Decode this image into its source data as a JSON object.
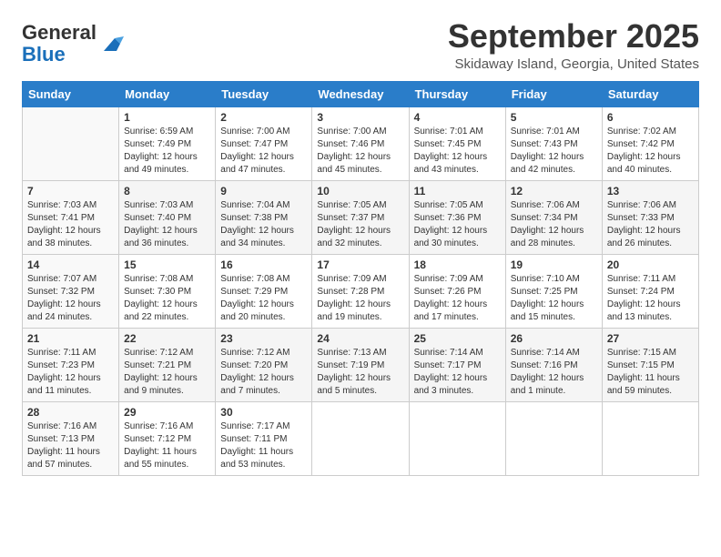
{
  "header": {
    "logo_line1": "General",
    "logo_line2": "Blue",
    "month": "September 2025",
    "location": "Skidaway Island, Georgia, United States"
  },
  "weekdays": [
    "Sunday",
    "Monday",
    "Tuesday",
    "Wednesday",
    "Thursday",
    "Friday",
    "Saturday"
  ],
  "weeks": [
    [
      {
        "day": "",
        "info": ""
      },
      {
        "day": "1",
        "info": "Sunrise: 6:59 AM\nSunset: 7:49 PM\nDaylight: 12 hours\nand 49 minutes."
      },
      {
        "day": "2",
        "info": "Sunrise: 7:00 AM\nSunset: 7:47 PM\nDaylight: 12 hours\nand 47 minutes."
      },
      {
        "day": "3",
        "info": "Sunrise: 7:00 AM\nSunset: 7:46 PM\nDaylight: 12 hours\nand 45 minutes."
      },
      {
        "day": "4",
        "info": "Sunrise: 7:01 AM\nSunset: 7:45 PM\nDaylight: 12 hours\nand 43 minutes."
      },
      {
        "day": "5",
        "info": "Sunrise: 7:01 AM\nSunset: 7:43 PM\nDaylight: 12 hours\nand 42 minutes."
      },
      {
        "day": "6",
        "info": "Sunrise: 7:02 AM\nSunset: 7:42 PM\nDaylight: 12 hours\nand 40 minutes."
      }
    ],
    [
      {
        "day": "7",
        "info": "Sunrise: 7:03 AM\nSunset: 7:41 PM\nDaylight: 12 hours\nand 38 minutes."
      },
      {
        "day": "8",
        "info": "Sunrise: 7:03 AM\nSunset: 7:40 PM\nDaylight: 12 hours\nand 36 minutes."
      },
      {
        "day": "9",
        "info": "Sunrise: 7:04 AM\nSunset: 7:38 PM\nDaylight: 12 hours\nand 34 minutes."
      },
      {
        "day": "10",
        "info": "Sunrise: 7:05 AM\nSunset: 7:37 PM\nDaylight: 12 hours\nand 32 minutes."
      },
      {
        "day": "11",
        "info": "Sunrise: 7:05 AM\nSunset: 7:36 PM\nDaylight: 12 hours\nand 30 minutes."
      },
      {
        "day": "12",
        "info": "Sunrise: 7:06 AM\nSunset: 7:34 PM\nDaylight: 12 hours\nand 28 minutes."
      },
      {
        "day": "13",
        "info": "Sunrise: 7:06 AM\nSunset: 7:33 PM\nDaylight: 12 hours\nand 26 minutes."
      }
    ],
    [
      {
        "day": "14",
        "info": "Sunrise: 7:07 AM\nSunset: 7:32 PM\nDaylight: 12 hours\nand 24 minutes."
      },
      {
        "day": "15",
        "info": "Sunrise: 7:08 AM\nSunset: 7:30 PM\nDaylight: 12 hours\nand 22 minutes."
      },
      {
        "day": "16",
        "info": "Sunrise: 7:08 AM\nSunset: 7:29 PM\nDaylight: 12 hours\nand 20 minutes."
      },
      {
        "day": "17",
        "info": "Sunrise: 7:09 AM\nSunset: 7:28 PM\nDaylight: 12 hours\nand 19 minutes."
      },
      {
        "day": "18",
        "info": "Sunrise: 7:09 AM\nSunset: 7:26 PM\nDaylight: 12 hours\nand 17 minutes."
      },
      {
        "day": "19",
        "info": "Sunrise: 7:10 AM\nSunset: 7:25 PM\nDaylight: 12 hours\nand 15 minutes."
      },
      {
        "day": "20",
        "info": "Sunrise: 7:11 AM\nSunset: 7:24 PM\nDaylight: 12 hours\nand 13 minutes."
      }
    ],
    [
      {
        "day": "21",
        "info": "Sunrise: 7:11 AM\nSunset: 7:23 PM\nDaylight: 12 hours\nand 11 minutes."
      },
      {
        "day": "22",
        "info": "Sunrise: 7:12 AM\nSunset: 7:21 PM\nDaylight: 12 hours\nand 9 minutes."
      },
      {
        "day": "23",
        "info": "Sunrise: 7:12 AM\nSunset: 7:20 PM\nDaylight: 12 hours\nand 7 minutes."
      },
      {
        "day": "24",
        "info": "Sunrise: 7:13 AM\nSunset: 7:19 PM\nDaylight: 12 hours\nand 5 minutes."
      },
      {
        "day": "25",
        "info": "Sunrise: 7:14 AM\nSunset: 7:17 PM\nDaylight: 12 hours\nand 3 minutes."
      },
      {
        "day": "26",
        "info": "Sunrise: 7:14 AM\nSunset: 7:16 PM\nDaylight: 12 hours\nand 1 minute."
      },
      {
        "day": "27",
        "info": "Sunrise: 7:15 AM\nSunset: 7:15 PM\nDaylight: 11 hours\nand 59 minutes."
      }
    ],
    [
      {
        "day": "28",
        "info": "Sunrise: 7:16 AM\nSunset: 7:13 PM\nDaylight: 11 hours\nand 57 minutes."
      },
      {
        "day": "29",
        "info": "Sunrise: 7:16 AM\nSunset: 7:12 PM\nDaylight: 11 hours\nand 55 minutes."
      },
      {
        "day": "30",
        "info": "Sunrise: 7:17 AM\nSunset: 7:11 PM\nDaylight: 11 hours\nand 53 minutes."
      },
      {
        "day": "",
        "info": ""
      },
      {
        "day": "",
        "info": ""
      },
      {
        "day": "",
        "info": ""
      },
      {
        "day": "",
        "info": ""
      }
    ]
  ]
}
